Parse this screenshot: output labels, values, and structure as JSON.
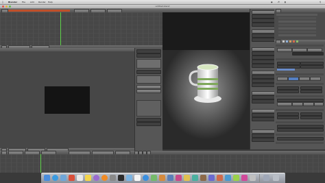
{
  "menubar": {
    "apple": "",
    "items": [
      "Blender",
      "File",
      "Add",
      "Render",
      "Help"
    ],
    "clock": "",
    "colors": {
      "bar": "#d6d6d6"
    }
  },
  "window": {
    "title": "untitled.blend"
  },
  "timeline_top": {
    "frame_label": "",
    "playhead_position_frac": 0.37
  },
  "render_view": {
    "status": "",
    "footer_frame": "",
    "background": "#141414"
  },
  "viewport": {
    "status": "",
    "footer_label": ""
  },
  "properties": {
    "sections": [
      "Render",
      "Dimensions",
      "Anti-Aliasing",
      "Shading",
      "Output",
      "Performance"
    ]
  },
  "timeline_bottom": {
    "playhead_position_frac": 0.04
  },
  "dock": {
    "icons": [
      "finder-icon",
      "safari-icon",
      "mail-icon",
      "photos-icon",
      "calendar-icon",
      "notes-icon",
      "itunes-icon",
      "blender-icon",
      "settings-icon",
      "terminal-icon",
      "preview-icon",
      "textedit-icon",
      "appstore-icon",
      "maps-icon",
      "trash-icon"
    ],
    "colors": [
      "#4a8ede",
      "#3b9be0",
      "#6fa6d8",
      "#d94f3a",
      "#e8e8e8",
      "#f3d44a",
      "#9a6bd1",
      "#f08a24",
      "#8a8a8a",
      "#2b2b2b",
      "#7bb4e3",
      "#f5f5f5",
      "#3a8fe0",
      "#74b96a",
      "#b9bec6"
    ]
  }
}
